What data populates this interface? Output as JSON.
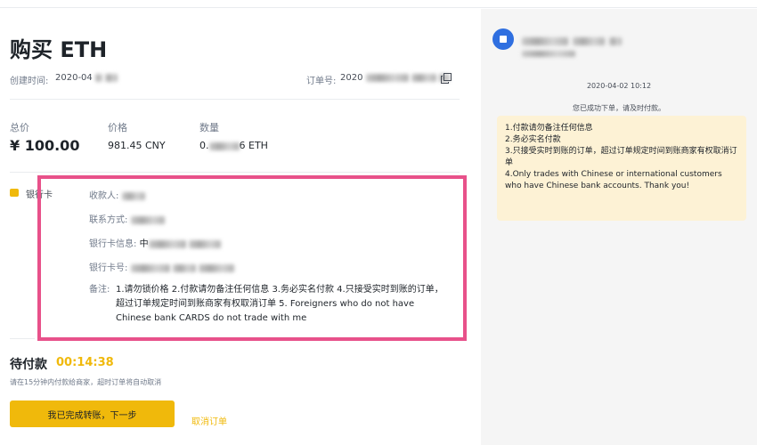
{
  "order": {
    "title": "购买 ETH",
    "created_label": "创建时间:",
    "created_value": "2020-04",
    "order_no_label": "订单号:",
    "order_no_value": "2020"
  },
  "stats": {
    "total_label": "总价",
    "total_value": "¥ 100.00",
    "price_label": "价格",
    "price_value": "981.45 CNY",
    "qty_label": "数量",
    "qty_value_prefix": "0.",
    "qty_value_suffix": "6 ETH"
  },
  "payment": {
    "method_label": "银行卡",
    "payee_label": "收款人:",
    "contact_label": "联系方式:",
    "bank_info_label": "银行卡信息:",
    "bank_info_prefix": "中",
    "card_no_label": "银行卡号:",
    "remark_label": "备注:",
    "remark_text": "1.请勿锁价格 2.付款请勿备注任何信息 3.务必实名付款 4.只接受实时到账的订单，超过订单规定时间到账商家有权取消订单 5. Foreigners who do not have Chinese bank CARDS do not trade with me"
  },
  "pending": {
    "title": "待付款",
    "timer": "00:14:38",
    "hint": "请在15分钟内付款给商家，超时订单将自动取消"
  },
  "actions": {
    "confirm_label": "我已完成转账，下一步",
    "cancel_label": "取消订单"
  },
  "chat": {
    "timestamp": "2020-04-02 10:12",
    "system_message": "您已成功下单，请及时付款。",
    "message_lines": [
      "1.付款请勿备注任何信息",
      "2.务必实名付款",
      "3.只接受实时到账的订单，超过订单规定时间到账商家有权取消订单",
      "4.Only trades with Chinese or international customers who have Chinese bank accounts. Thank you!"
    ]
  },
  "colors": {
    "accent": "#f0b90b",
    "highlight_border": "#e8518a",
    "chat_bubble": "#fdf2d5",
    "avatar": "#2f6fe0"
  }
}
